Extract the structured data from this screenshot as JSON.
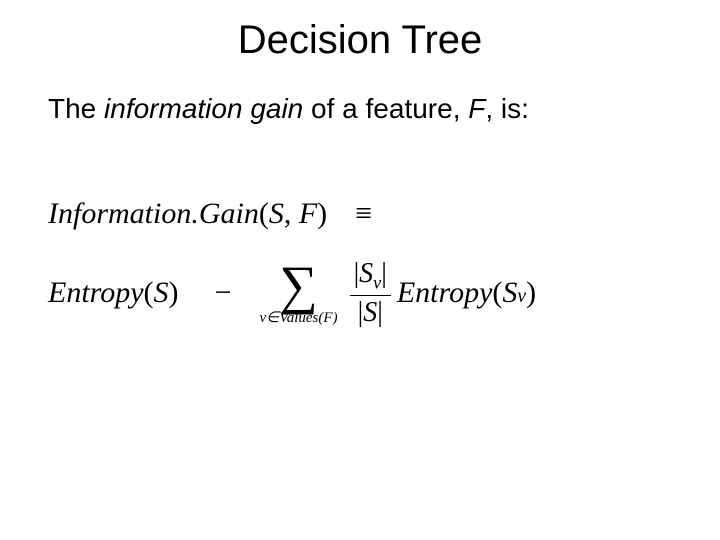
{
  "title": "Decision Tree",
  "body": {
    "prefix": "The ",
    "italic_term": "information gain",
    "mid": " of a feature, ",
    "italic_var": "F",
    "suffix": ", is:"
  },
  "formula": {
    "fn1": "Information.Gain",
    "args1_open": "(",
    "args1_s": "S",
    "args1_comma": ", ",
    "args1_f": "F",
    "args1_close": ")",
    "equiv": "≡",
    "fn2": "Entropy",
    "args2_open": "(",
    "args2_s": "S",
    "args2_close": ")",
    "minus": "−",
    "sigma": "∑",
    "sum_sub_v": "v",
    "sum_sub_in": "∈",
    "sum_sub_values": "Values",
    "sum_sub_open": "(",
    "sum_sub_f": "F",
    "sum_sub_close": ")",
    "frac_num_bar1": "|",
    "frac_num_s": "S",
    "frac_num_sub": "v",
    "frac_num_bar2": "|",
    "frac_den_bar1": "|",
    "frac_den_s": "S",
    "frac_den_bar2": "|",
    "fn3": "Entropy",
    "args3_open": "(",
    "args3_s": "S",
    "args3_sub": "v",
    "args3_close": ")"
  }
}
